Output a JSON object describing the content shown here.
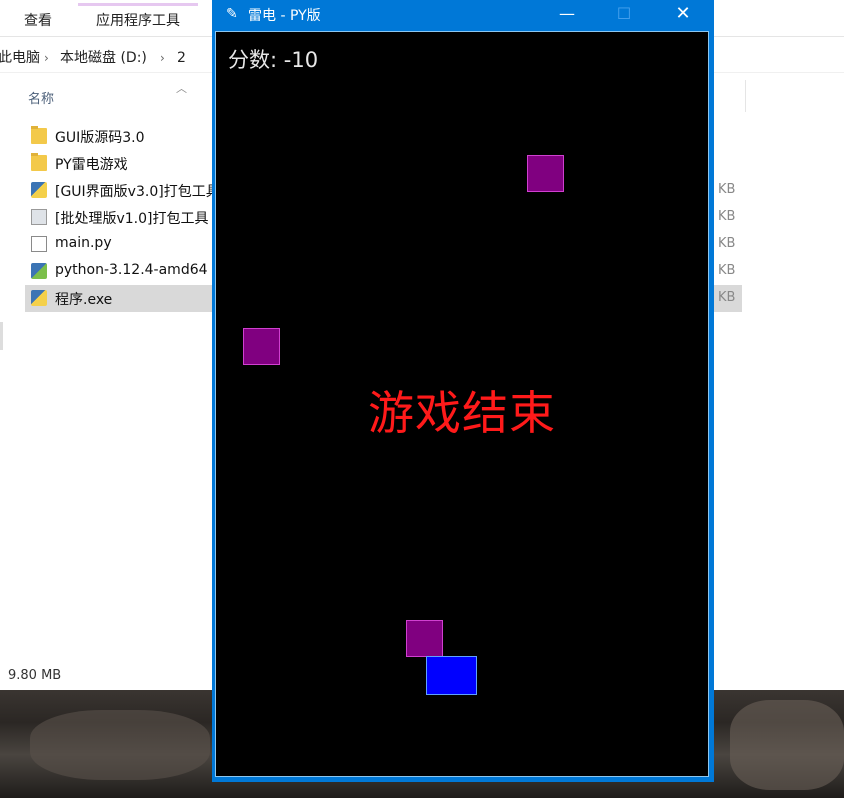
{
  "explorer": {
    "ribbon_tabs": [
      "查看",
      "应用程序工具"
    ],
    "breadcrumb": [
      "此电脑",
      "本地磁盘 (D:)",
      "2"
    ],
    "column_header": "名称",
    "files": [
      {
        "name": "GUI版源码3.0",
        "type": "folder",
        "size": ""
      },
      {
        "name": "PY雷电游戏",
        "type": "folder",
        "size": ""
      },
      {
        "name": "[GUI界面版v3.0]打包工具",
        "type": "exe",
        "size": "KB"
      },
      {
        "name": "[批处理版v1.0]打包工具",
        "type": "bat",
        "size": "KB"
      },
      {
        "name": "main.py",
        "type": "py",
        "size": "KB"
      },
      {
        "name": "python-3.12.4-amd64",
        "type": "installer",
        "size": "KB"
      },
      {
        "name": "程序.exe",
        "type": "exe",
        "size": "KB",
        "selected": true
      }
    ],
    "status": "9.80 MB"
  },
  "game_window": {
    "title": "雷电 - PY版",
    "icon": "feather-icon",
    "score_label": "分数:",
    "score_value": "-10",
    "game_over_text": "游戏结束",
    "colors": {
      "background": "#000000",
      "enemy": "#800080",
      "player": "#0000ff",
      "game_over": "#ff0000",
      "titlebar": "#0078d7"
    }
  }
}
